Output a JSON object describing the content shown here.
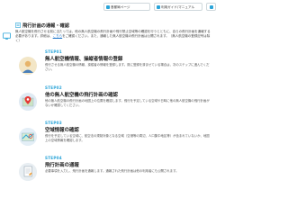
{
  "toolbar": {
    "home_label": "首都局ページ",
    "guide_label": "利用ガイド/マニュアル",
    "extra_label": ""
  },
  "section": {
    "title": "飛行計画の通報・確認",
    "intro_before_link": "無人航空機を飛行させる前に当たっては、他の無人航空機の飛行計画や飛行禁止空域等の確認を行うとともに、自らの飛行計画を通報する必要があります。詳細は、",
    "intro_link": "こちら",
    "intro_after_link": "をご確認ください。また、通報した無人航空機の飛行計画は公開されます。（無人航空機の登録記号は除く）"
  },
  "steps": [
    {
      "label": "STEP01",
      "heading": "無人航空機情報、操縦者情報の登録",
      "body": "飛行させる無人航空機の情報、操縦者の情報を登録します。既に登録を済ませている場合は、次のステップに進んでください。"
    },
    {
      "label": "STEP02",
      "heading": "他の無人航空機の飛行計画の確認",
      "body": "他の無人航空機の飛行計画の地図上の位置を確認します。飛行を予定している空域や日時に他の無人航空機の飛行計画がないか確認してください。"
    },
    {
      "label": "STEP03",
      "heading": "空域情報の確認",
      "body": "飛行を予定している空域に、航空法の規制対象となる空域（空港等の周辺、人口集中地区等）が含まれていないか、地図上の空域情報を確認します。"
    },
    {
      "label": "STEP04",
      "heading": "飛行計画の通報",
      "body": "必要事項を入力し、飛行計画を通報します。通報された飛行計画は他の利用者にも公開されます。"
    }
  ]
}
